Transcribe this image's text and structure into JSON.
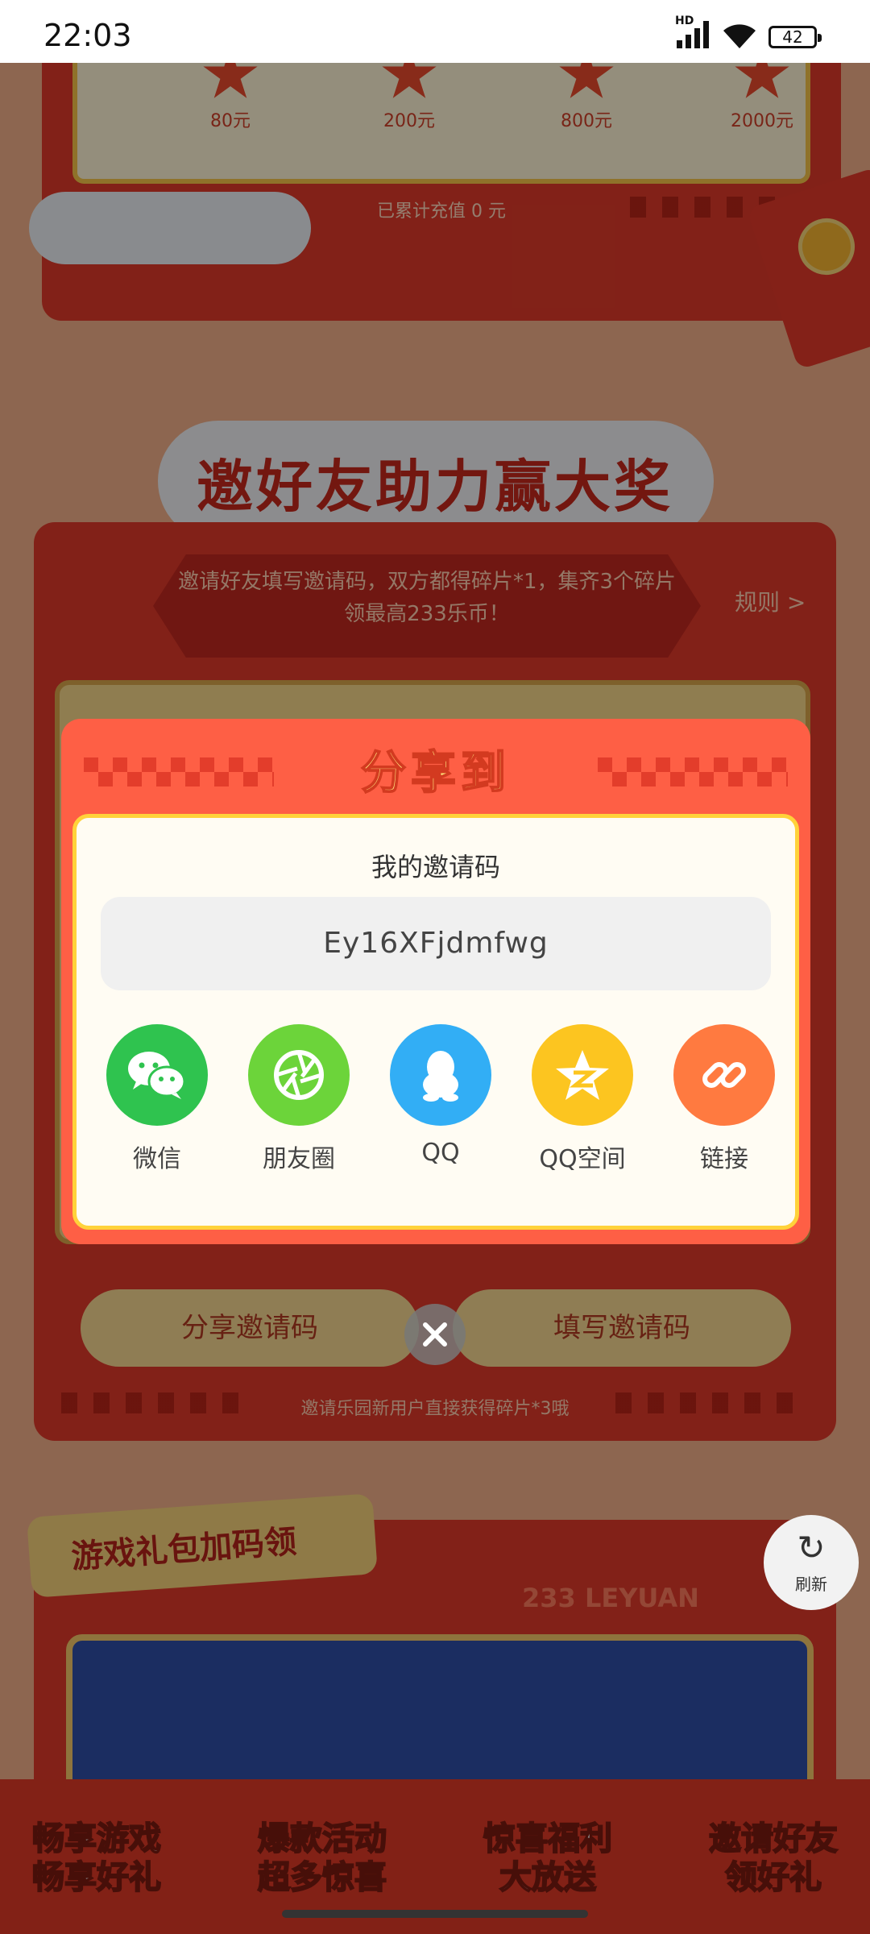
{
  "status_bar": {
    "time": "22:03",
    "network": "HD",
    "battery": "42"
  },
  "recharge": {
    "rewards": [
      "80元",
      "200元",
      "800元",
      "2000元"
    ],
    "total_text": "已累计充值 0 元"
  },
  "invite_section": {
    "title": "邀好友助力赢大奖",
    "banner_text": "邀请好友填写邀请码，双方都得碎片*1，集齐3个碎片领最高233乐币！",
    "rules_link": "规则 >",
    "share_code_button": "分享邀请码",
    "fill_code_button": "填写邀请码",
    "note": "邀请乐园新用户直接获得碎片*3哦"
  },
  "gift_section": {
    "tag": "游戏礼包加码领",
    "brand": "233 LEYUAN"
  },
  "refresh_button": {
    "label": "刷新"
  },
  "bottom_nav": [
    {
      "line1": "畅享游戏",
      "line2": "畅享好礼"
    },
    {
      "line1": "爆款活动",
      "line2": "超多惊喜"
    },
    {
      "line1": "惊喜福利",
      "line2": "大放送"
    },
    {
      "line1": "邀请好友",
      "line2": "领好礼"
    }
  ],
  "share_dialog": {
    "title": "分享到",
    "code_label": "我的邀请码",
    "code_value": "Ey16XFjdmfwg",
    "targets": [
      {
        "label": "微信",
        "icon": "wechat-icon",
        "color": "#2fc34f"
      },
      {
        "label": "朋友圈",
        "icon": "moments-icon",
        "color": "#6cd43a"
      },
      {
        "label": "QQ",
        "icon": "qq-icon",
        "color": "#32aef5"
      },
      {
        "label": "QQ空间",
        "icon": "qzone-icon",
        "color": "#fcc520"
      },
      {
        "label": "链接",
        "icon": "link-icon",
        "color": "#ff7a40"
      }
    ]
  },
  "colors": {
    "dialog_red": "#fe5f45",
    "dialog_title_yellow": "#ffe27a",
    "page_red": "#e1392a"
  }
}
